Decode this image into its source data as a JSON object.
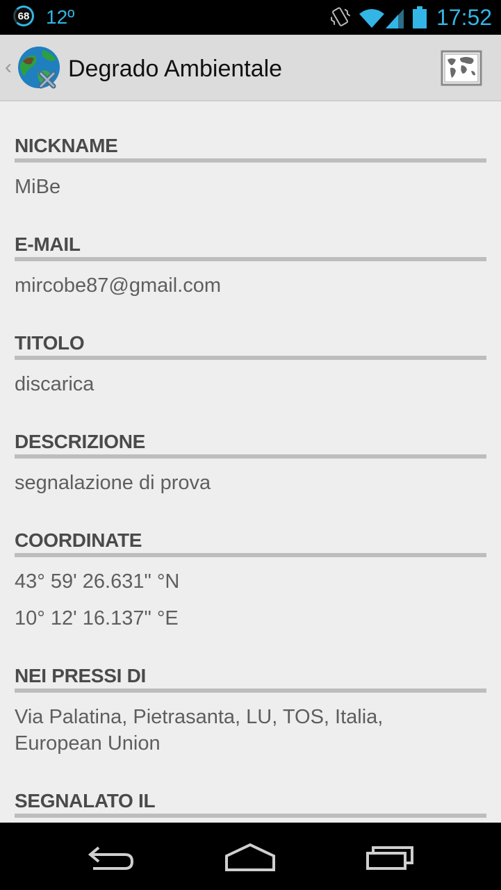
{
  "status_bar": {
    "battery_percent": "68",
    "temperature": "12º",
    "time": "17:52",
    "icons": [
      "battery-percent-icon",
      "vibrate-icon",
      "wifi-icon",
      "signal-icon",
      "battery-icon"
    ]
  },
  "action_bar": {
    "up_caret": "‹",
    "title": "Degrado Ambientale",
    "logo_icon": "globe-logo-icon",
    "map_icon": "world-map-icon"
  },
  "fields": {
    "nickname": {
      "label": "NICKNAME",
      "value": "MiBe"
    },
    "email": {
      "label": "E-MAIL",
      "value": "mircobe87@gmail.com"
    },
    "titolo": {
      "label": "TITOLO",
      "value": "discarica"
    },
    "descrizione": {
      "label": "DESCRIZIONE",
      "value": "segnalazione di prova"
    },
    "coordinate": {
      "label": "COORDINATE",
      "lat": "43° 59' 26.631\" °N",
      "lon": "10° 12' 16.137\" °E"
    },
    "nei_pressi": {
      "label": "NEI PRESSI DI",
      "value": "Via Palatina, Pietrasanta, LU, TOS, Italia, European Union"
    },
    "segnalato_il": {
      "label": "SEGNALATO IL"
    }
  },
  "nav_bar": {
    "icons": [
      "back-icon",
      "home-icon",
      "recent-apps-icon"
    ]
  },
  "colors": {
    "accent": "#33b5e5",
    "action_bar_bg": "#dcdcdc",
    "content_bg": "#eeeeee",
    "header_text": "#4a4a4a",
    "value_text": "#5e5e5e",
    "rule": "#bdbdbd"
  }
}
